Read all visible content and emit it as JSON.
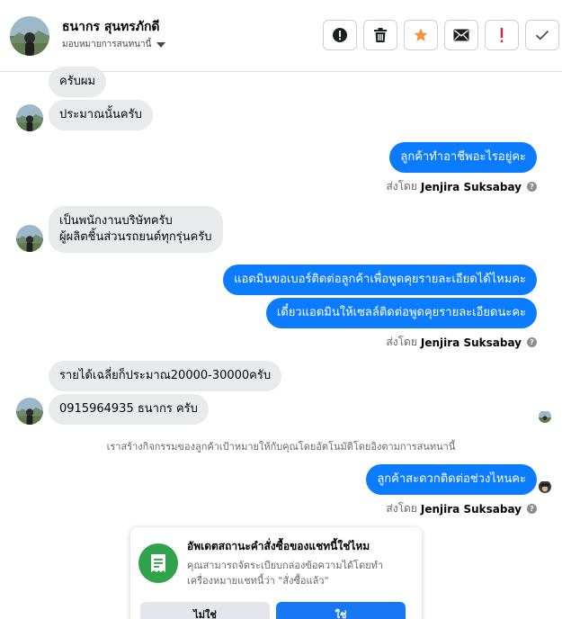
{
  "header": {
    "contact_name": "ธนากร สุนทรภักดี",
    "assign_label": "มอบหมายการสนทนานี้",
    "actions": [
      {
        "icon": "alert-circle-icon",
        "name": "mark-spam-button"
      },
      {
        "icon": "trash-icon",
        "name": "delete-button"
      },
      {
        "icon": "star-icon",
        "name": "star-button"
      },
      {
        "icon": "envelope-icon",
        "name": "mark-unread-button"
      },
      {
        "icon": "exclamation-icon",
        "name": "follow-up-button"
      },
      {
        "icon": "checkmark-icon",
        "name": "mark-done-button"
      }
    ]
  },
  "messages": {
    "m1": "ครับผม",
    "m2": "ประมาณนั้นครับ",
    "m3": "ลูกค้าทำอาชีพอะไรอยู่คะ",
    "m4_line1": "เป็นพนักงานบริษัทครับ",
    "m4_line2": "ผู้ผลิตชิ้นส่วนรถยนต์ทุกรุ่นครับ",
    "m5": "แอดมินขอเบอร์ติดต่อลูกค้าเพื่อพูดคุยรายละเอียดได้ไหมคะ",
    "m6": "เดี๋ยวแอดมินให้เซลล์ติดต่อพูดคุยรายละเอียดนะคะ",
    "m7": "รายได้เฉลี่ยก็ประมาณ20000-30000ครับ",
    "m8": "0915964935 ธนากร ครับ",
    "m9": "ลูกค้าสะดวกติดต่อช่วงไหนคะ"
  },
  "sent_by": {
    "prefix": "ส่งโดย",
    "agent": "Jenjira Suksabay",
    "help": "?"
  },
  "system_note": "เราสร้างกิจกรรมของลูกค้าเป้าหมายให้กับคุณโดยอัตโนมัติโดยอิงตามการสนทนานี้",
  "card": {
    "title": "อัพเดตสถานะคำสั่งซื้อของแชทนี้ใช่ไหม",
    "body": "คุณสามารถจัดระเบียบกล่องข้อความได้โดยทำเครื่องหมายแชทนี้ว่า \"สั่งซื้อแล้ว\"",
    "no_label": "ไม่ใช่",
    "yes_label": "ใช่"
  },
  "colors": {
    "outgoing_bubble": "#0b7bff",
    "incoming_bubble": "#e9eaec",
    "star": "#f7923b",
    "alert_red": "#e41e3f",
    "order_icon_bg": "#31a24c"
  }
}
